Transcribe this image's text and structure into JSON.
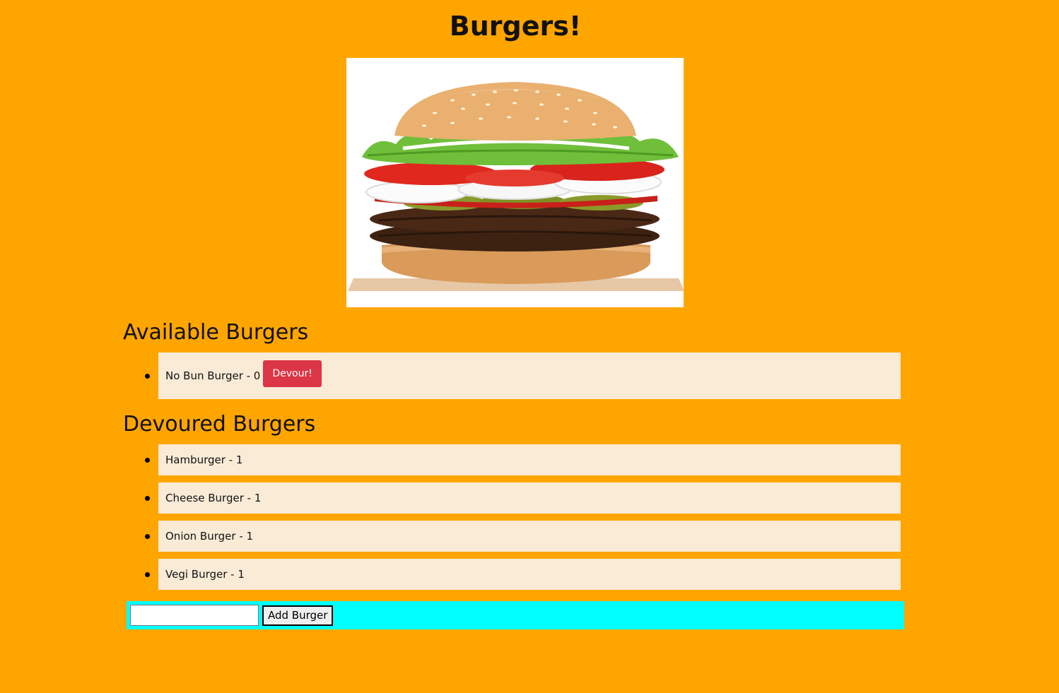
{
  "header": {
    "title": "Burgers!"
  },
  "hero": {
    "image_icon": "burger-image"
  },
  "available": {
    "heading": "Available Burgers",
    "items": [
      {
        "label": "No Bun Burger - 0",
        "button": "Devour!"
      }
    ]
  },
  "devoured": {
    "heading": "Devoured Burgers",
    "items": [
      {
        "label": "Hamburger - 1"
      },
      {
        "label": "Cheese Burger - 1"
      },
      {
        "label": "Onion Burger - 1"
      },
      {
        "label": "Vegi Burger - 1"
      }
    ]
  },
  "form": {
    "input_value": "",
    "input_placeholder": "",
    "button": "Add Burger"
  },
  "colors": {
    "page_background": "#ffa500",
    "list_item_background": "#faebd7",
    "devour_button": "#dc3545",
    "form_background": "#00ffff"
  }
}
